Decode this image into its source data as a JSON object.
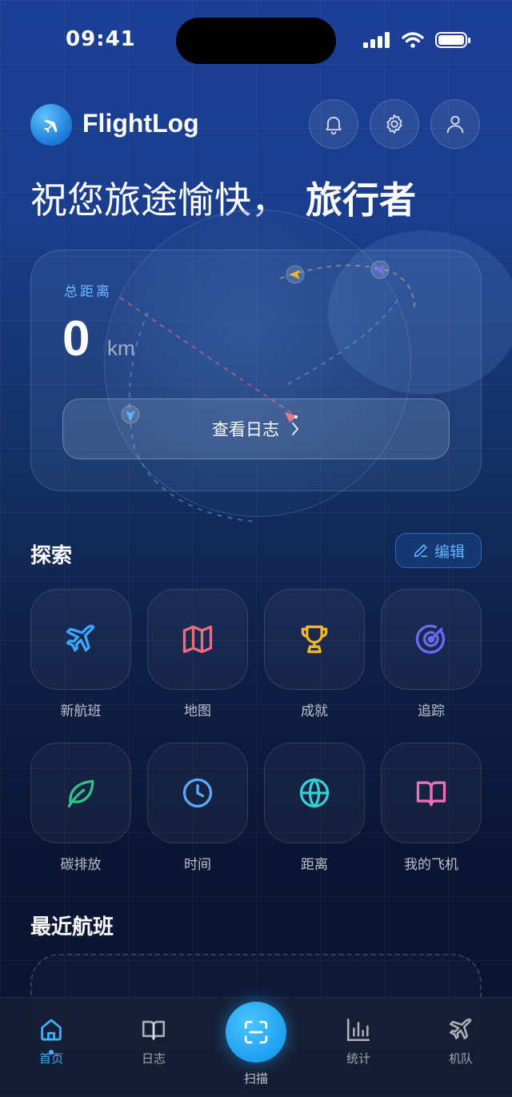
{
  "status_bar": {
    "time": "09:41"
  },
  "header": {
    "app_name": "FlightLog"
  },
  "greeting": {
    "text": "祝您旅途愉快，",
    "name": "旅行者"
  },
  "distance_card": {
    "label": "总距离",
    "value": "0",
    "unit": "km",
    "button_label": "查看日志"
  },
  "explore": {
    "title": "探索",
    "edit_label": "编辑",
    "items": [
      {
        "label": "新航班",
        "icon": "plane-icon",
        "color": "#3aa8ff"
      },
      {
        "label": "地图",
        "icon": "map-icon",
        "color": "#f06b7e"
      },
      {
        "label": "成就",
        "icon": "trophy-icon",
        "color": "#f2b52a"
      },
      {
        "label": "追踪",
        "icon": "radar-icon",
        "color": "#6b6af5"
      },
      {
        "label": "碳排放",
        "icon": "leaf-icon",
        "color": "#2fc38a"
      },
      {
        "label": "时间",
        "icon": "clock-icon",
        "color": "#5aa8ff"
      },
      {
        "label": "距离",
        "icon": "globe-icon",
        "color": "#2ed2d6"
      },
      {
        "label": "我的飞机",
        "icon": "book-icon",
        "color": "#f06eb6"
      }
    ]
  },
  "recent": {
    "title": "最近航班"
  },
  "tabbar": {
    "home": "首页",
    "log": "日志",
    "scan": "扫描",
    "stats": "统计",
    "fleet": "机队"
  }
}
